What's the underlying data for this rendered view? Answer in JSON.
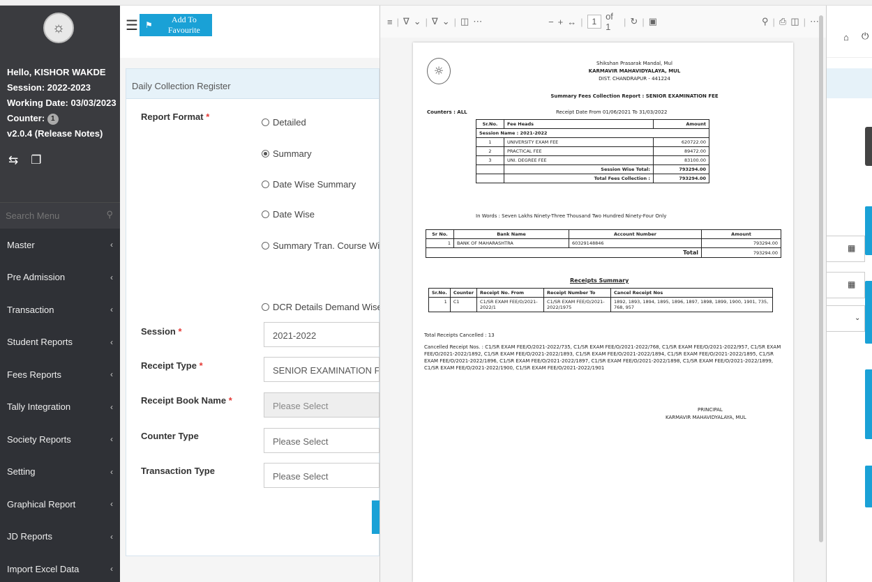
{
  "sidebar": {
    "greeting": "Hello, KISHOR WAKDE",
    "session": "Session: 2022-2023",
    "working_date": "Working Date: 03/03/2023",
    "counter_label": "Counter:",
    "counter_value": "1",
    "version": "v2.0.4 (Release Notes)",
    "search_placeholder": "Search Menu",
    "menu": [
      "Master",
      "Pre Admission",
      "Transaction",
      "Student Reports",
      "Fees Reports",
      "Tally Integration",
      "Society Reports",
      "Setting",
      "Graphical Report",
      "JD Reports",
      "Import Excel Data"
    ]
  },
  "topbar": {
    "fav_label": "Add To Favourite"
  },
  "panel": {
    "title": "Daily Collection Register",
    "report_format_label": "Report Format",
    "radios": [
      "Detailed",
      "Summary",
      "Date Wise Summary",
      "Date Wise",
      "Summary Tran. Course Wise",
      "DCR Details Demand Wise"
    ],
    "selected_radio": "Summary",
    "session_label": "Session",
    "session_value": "2021-2022",
    "receipt_type_label": "Receipt Type",
    "receipt_type_value": "SENIOR EXAMINATION FEE",
    "receipt_book_label": "Receipt Book Name",
    "receipt_book_value": "Please Select",
    "counter_type_label": "Counter Type",
    "counter_type_value": "Please Select",
    "transaction_type_label": "Transaction Type",
    "transaction_type_value": "Please Select",
    "required_mark": "*"
  },
  "pdf_toolbar": {
    "page": "1",
    "of": "of 1"
  },
  "document": {
    "org": "Shikshan Prasarak Mandal, Mul",
    "college": "KARMAVIR MAHAVIDYALAYA, MUL",
    "district": "DIST. CHANDRAPUR - 441224",
    "report_title": "Summary Fees Collection Report : SENIOR EXAMINATION FEE",
    "counters": "Counters : ALL",
    "receipt_date": "Receipt Date From 01/06/2021 To 31/03/2022",
    "fee_headers": [
      "Sr.No.",
      "Fee Heads",
      "Amount"
    ],
    "session_name": "Session Name : 2021-2022",
    "fee_rows": [
      {
        "sr": "1",
        "head": "UNIVERSITY EXAM FEE",
        "amount": "620722.00"
      },
      {
        "sr": "2",
        "head": "PRACTICAL FEE",
        "amount": "89472.00"
      },
      {
        "sr": "3",
        "head": "UNI. DEGREE FEE",
        "amount": "83100.00"
      }
    ],
    "session_total_label": "Session Wise Total:",
    "session_total": "793294.00",
    "total_collection_label": "Total Fees Collection :",
    "total_collection": "793294.00",
    "in_words": "In Words : Seven Lakhs Ninety-Three Thousand Two Hundred Ninety-Four Only",
    "bank_headers": [
      "Sr No.",
      "Bank Name",
      "Account Number",
      "Amount"
    ],
    "bank_row": {
      "sr": "1",
      "bank": "BANK OF MAHARASHTRA",
      "account": "60329148846",
      "amount": "793294.00"
    },
    "bank_total_label": "Total",
    "bank_total": "793294.00",
    "receipts_summary_title": "Receipts Summary",
    "receipt_headers": [
      "Sr.No.",
      "Counter",
      "Receipt No. From",
      "Receipt Number To",
      "Cancel Receipt Nos"
    ],
    "receipt_row": {
      "sr": "1",
      "counter": "C1",
      "from": "C1/SR EXAM FEE/O/2021-2022/1",
      "to": "C1/SR EXAM FEE/O/2021-2022/1975",
      "cancel": "1892, 1893, 1894, 1895, 1896, 1897, 1898, 1899, 1900, 1901, 735, 768, 957"
    },
    "total_cancelled": "Total Receipts Cancelled : 13",
    "cancelled_nos": "Cancelled Receipt Nos. : C1/SR EXAM FEE/O/2021-2022/735, C1/SR EXAM FEE/O/2021-2022/768, C1/SR EXAM FEE/O/2021-2022/957, C1/SR EXAM FEE/O/2021-2022/1892, C1/SR EXAM FEE/O/2021-2022/1893, C1/SR EXAM FEE/O/2021-2022/1894, C1/SR EXAM FEE/O/2021-2022/1895, C1/SR EXAM FEE/O/2021-2022/1896, C1/SR EXAM FEE/O/2021-2022/1897, C1/SR EXAM FEE/O/2021-2022/1898, C1/SR EXAM FEE/O/2021-2022/1899, C1/SR EXAM FEE/O/2021-2022/1900, C1/SR EXAM FEE/O/2021-2022/1901",
    "signatory": "PRINCIPAL",
    "signatory_org": "KARMAVIR MAHAVIDYALAYA, MUL"
  },
  "colors": {
    "accent": "#1aa1d6",
    "sidebar": "#2f3136",
    "panel_header": "#e6f2f9",
    "required": "#e53935"
  },
  "icons": [
    "hamburger-icon",
    "bookmark-icon",
    "refresh-icon",
    "document-icon",
    "search-icon",
    "chevron-left-icon",
    "calendar-icon",
    "chevron-down-icon",
    "home-icon",
    "power-icon",
    "zoom-out-icon",
    "zoom-in-icon",
    "fit-icon",
    "rotate-icon",
    "print-icon",
    "save-icon",
    "more-icon"
  ]
}
